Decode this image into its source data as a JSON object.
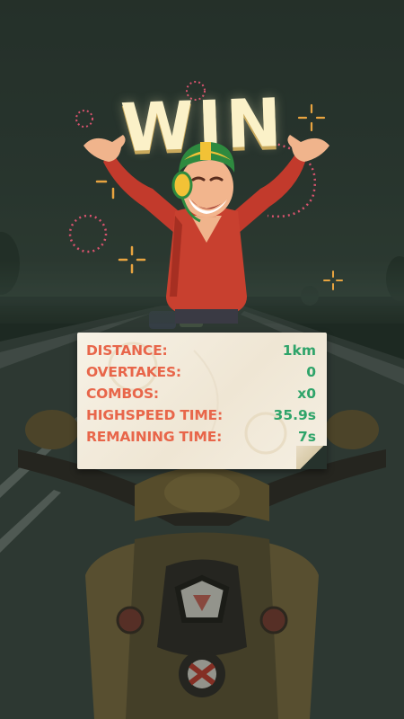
{
  "title": "WIN",
  "colors": {
    "label": "#e8664a",
    "value": "#2fa46a",
    "title": "#fbf1c8",
    "card": "#f3ecdd",
    "background": "#26322c"
  },
  "stats": [
    {
      "label": "DISTANCE:",
      "value": "1km"
    },
    {
      "label": "OVERTAKES:",
      "value": "0"
    },
    {
      "label": "COMBOS:",
      "value": "x0"
    },
    {
      "label": "HIGHSPEED TIME:",
      "value": "35.9s"
    },
    {
      "label": "REMAINING TIME:",
      "value": "7s"
    }
  ],
  "icons": [
    "firework-sparkle-icon",
    "character-celebrating",
    "motorcycle-headlight"
  ]
}
